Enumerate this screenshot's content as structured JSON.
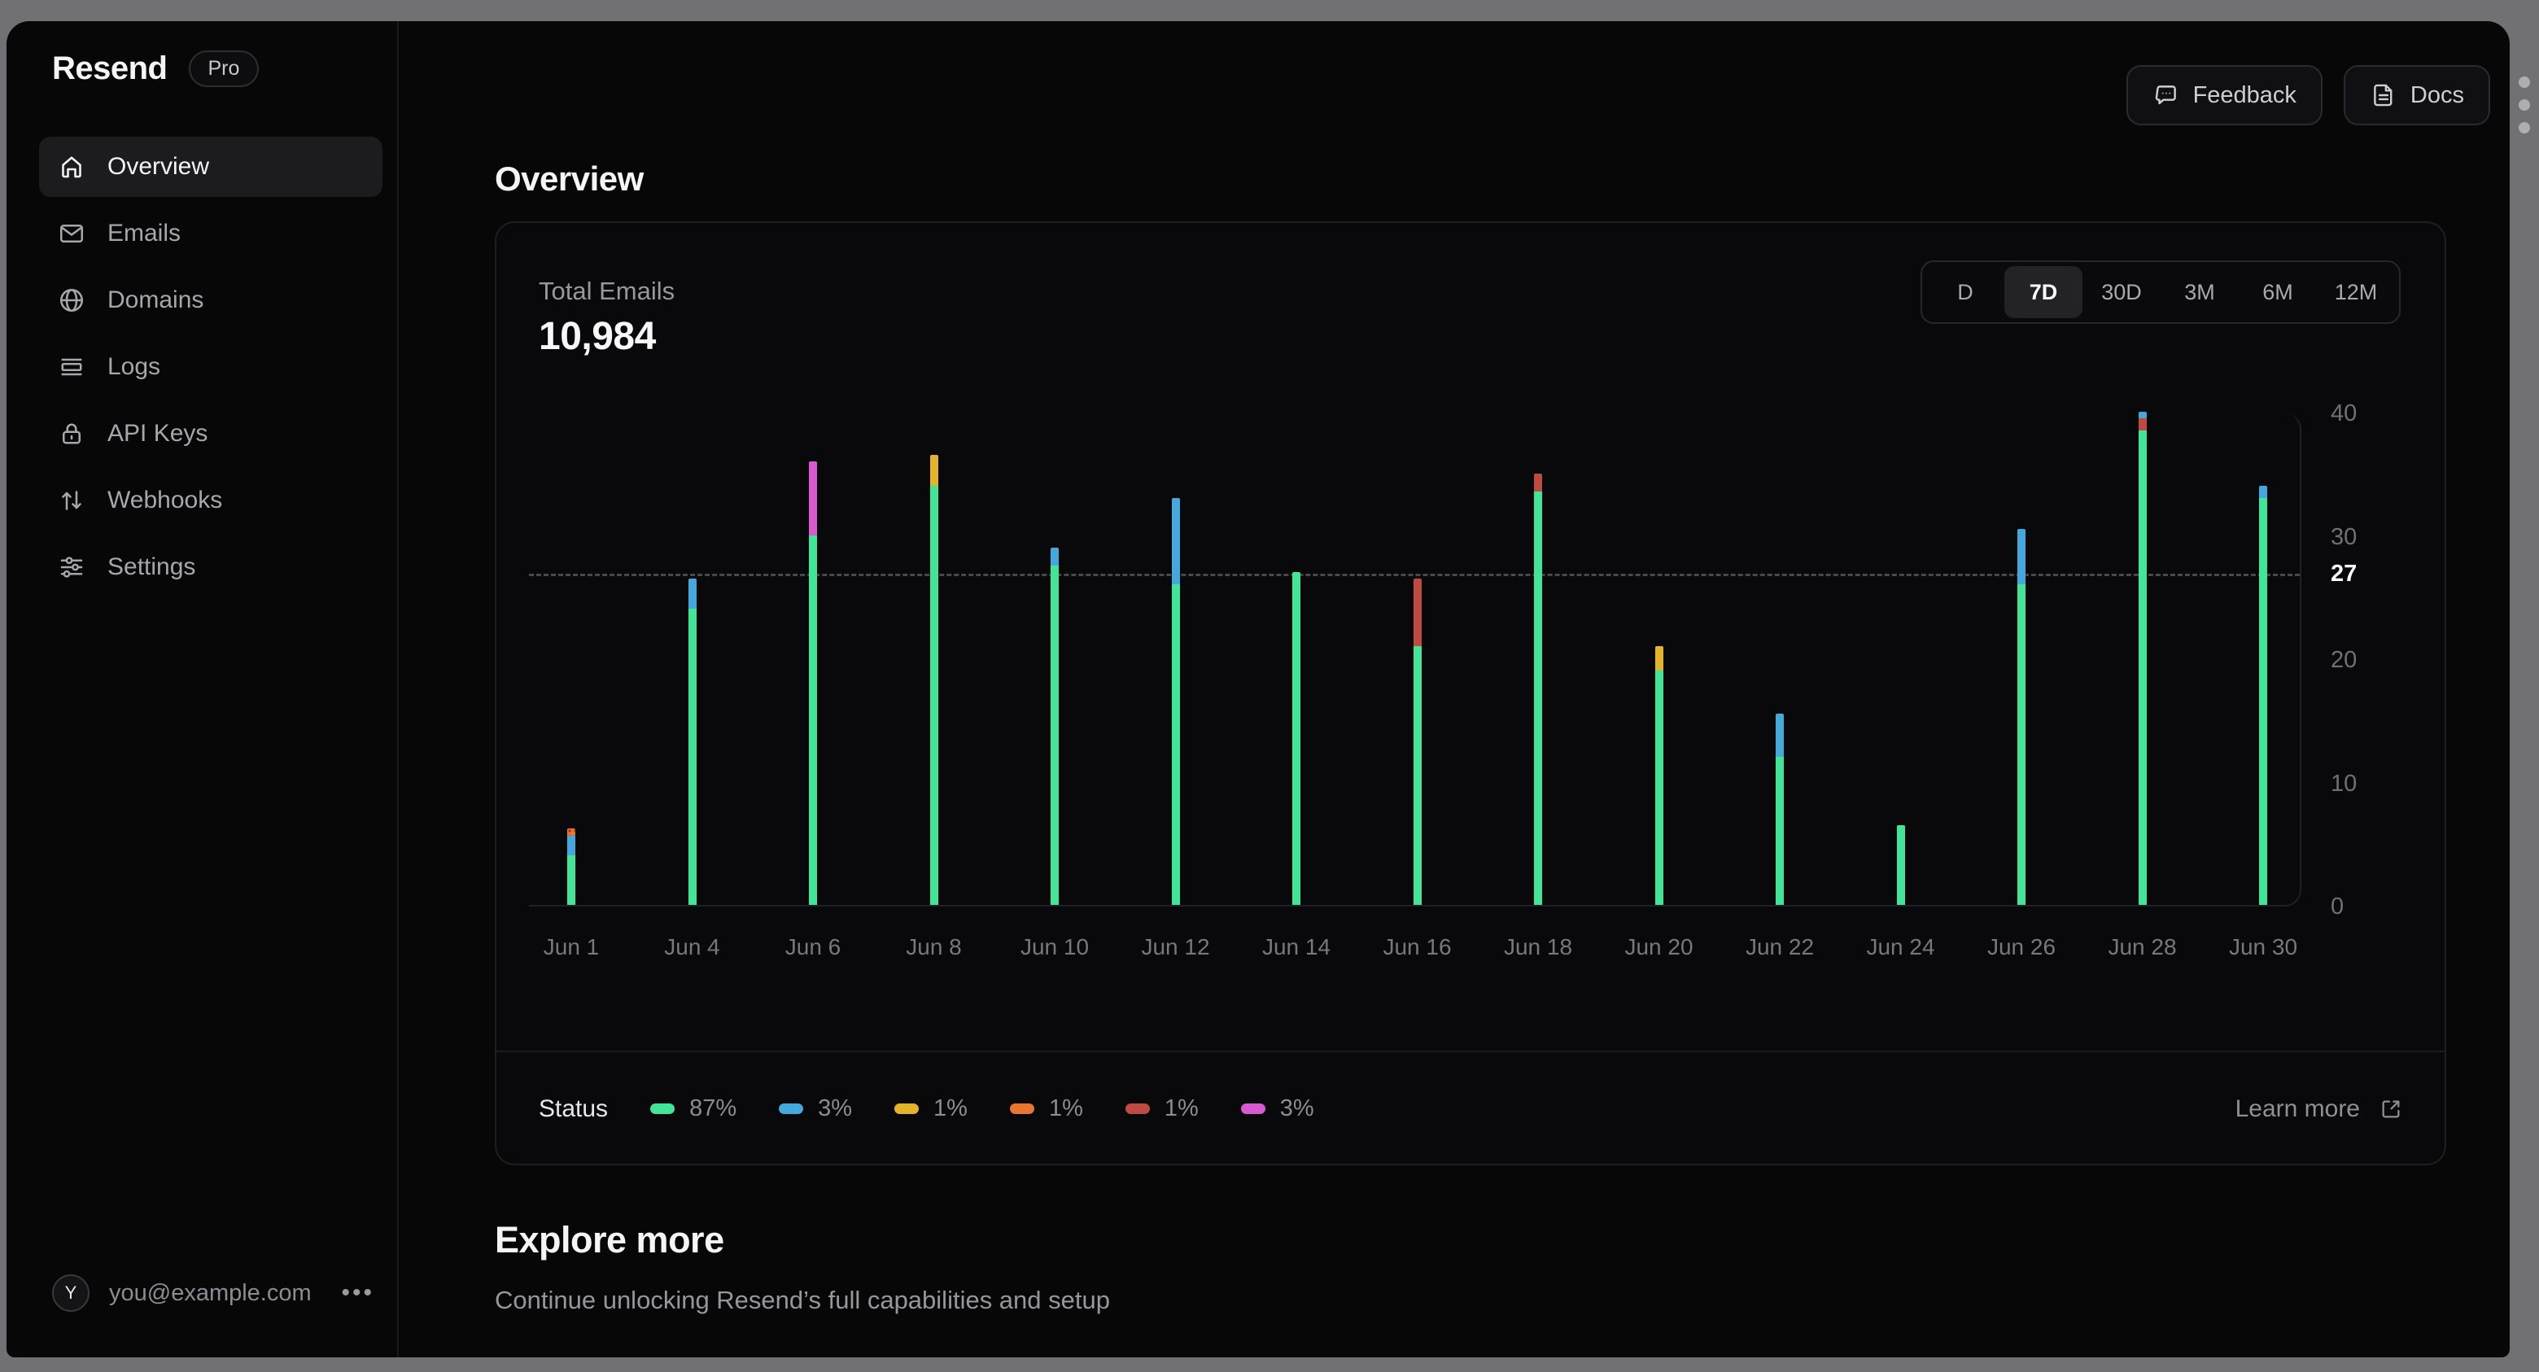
{
  "sidebar": {
    "logo": "Resend",
    "plan_badge": "Pro",
    "items": [
      {
        "label": "Overview",
        "icon": "home",
        "active": true
      },
      {
        "label": "Emails",
        "icon": "mail",
        "active": false
      },
      {
        "label": "Domains",
        "icon": "globe",
        "active": false
      },
      {
        "label": "Logs",
        "icon": "logs",
        "active": false
      },
      {
        "label": "API Keys",
        "icon": "lock",
        "active": false
      },
      {
        "label": "Webhooks",
        "icon": "arrows-up-down",
        "active": false
      },
      {
        "label": "Settings",
        "icon": "sliders",
        "active": false
      }
    ],
    "account": {
      "avatar_initial": "Y",
      "email": "you@example.com",
      "menu_icon": "•••"
    }
  },
  "header": {
    "buttons": [
      {
        "label": "Feedback",
        "icon": "feedback-bubble"
      },
      {
        "label": "Docs",
        "icon": "document"
      }
    ]
  },
  "page": {
    "title": "Overview"
  },
  "card": {
    "stat_label": "Total Emails",
    "stat_value": "10,984",
    "time_ranges": [
      {
        "label": "D",
        "active": false
      },
      {
        "label": "7D",
        "active": true
      },
      {
        "label": "30D",
        "active": false
      },
      {
        "label": "3M",
        "active": false
      },
      {
        "label": "6M",
        "active": false
      },
      {
        "label": "12M",
        "active": false
      }
    ],
    "footer": {
      "legend_label": "Status",
      "learn_more_label": "Learn more"
    }
  },
  "explore": {
    "title": "Explore more",
    "subtitle": "Continue unlocking Resend’s full capabilities and setup"
  },
  "chart_data": {
    "type": "bar",
    "stacked": true,
    "title": "Total Emails",
    "x_labels": [
      "Jun 1",
      "Jun 4",
      "Jun 6",
      "Jun 8",
      "Jun 10",
      "Jun 12",
      "Jun 14",
      "Jun 16",
      "Jun 18",
      "Jun 20",
      "Jun 22",
      "Jun 24",
      "Jun 26",
      "Jun 28",
      "Jun 30"
    ],
    "ylim": [
      0,
      40
    ],
    "yticks": [
      0,
      10,
      20,
      30,
      40
    ],
    "reference_line": {
      "value": 27,
      "style": "dashed"
    },
    "status_colors": {
      "green": "#42e598",
      "blue": "#45a8dc",
      "yellow": "#e3b42a",
      "orange": "#e8762f",
      "red": "#bf4a41",
      "magenta": "#d85ad0"
    },
    "bars": [
      {
        "date": "Jun 1",
        "segments": [
          {
            "status": "green",
            "value": 4
          },
          {
            "status": "blue",
            "value": 1.6
          },
          {
            "status": "orange",
            "value": 0.6
          }
        ]
      },
      {
        "date": "Jun 4",
        "segments": [
          {
            "status": "green",
            "value": 24
          },
          {
            "status": "blue",
            "value": 2.5
          }
        ]
      },
      {
        "date": "Jun 6",
        "segments": [
          {
            "status": "green",
            "value": 30
          },
          {
            "status": "magenta",
            "value": 6
          }
        ]
      },
      {
        "date": "Jun 8",
        "segments": [
          {
            "status": "green",
            "value": 34
          },
          {
            "status": "yellow",
            "value": 2.5
          }
        ]
      },
      {
        "date": "Jun 10",
        "segments": [
          {
            "status": "green",
            "value": 27.5
          },
          {
            "status": "blue",
            "value": 1.5
          }
        ]
      },
      {
        "date": "Jun 12",
        "segments": [
          {
            "status": "green",
            "value": 26
          },
          {
            "status": "blue",
            "value": 7
          }
        ]
      },
      {
        "date": "Jun 14",
        "segments": [
          {
            "status": "green",
            "value": 27
          }
        ]
      },
      {
        "date": "Jun 16",
        "segments": [
          {
            "status": "green",
            "value": 21
          },
          {
            "status": "red",
            "value": 5.5
          }
        ]
      },
      {
        "date": "Jun 18",
        "segments": [
          {
            "status": "green",
            "value": 33.5
          },
          {
            "status": "red",
            "value": 1.5
          }
        ]
      },
      {
        "date": "Jun 20",
        "segments": [
          {
            "status": "green",
            "value": 19
          },
          {
            "status": "yellow",
            "value": 2
          }
        ]
      },
      {
        "date": "Jun 22",
        "segments": [
          {
            "status": "green",
            "value": 12
          },
          {
            "status": "blue",
            "value": 3.5
          }
        ]
      },
      {
        "date": "Jun 24",
        "segments": [
          {
            "status": "green",
            "value": 6.5
          }
        ]
      },
      {
        "date": "Jun 26",
        "segments": [
          {
            "status": "green",
            "value": 26
          },
          {
            "status": "blue",
            "value": 4.5
          }
        ]
      },
      {
        "date": "Jun 28",
        "segments": [
          {
            "status": "green",
            "value": 38.5
          },
          {
            "status": "red",
            "value": 1
          },
          {
            "status": "blue",
            "value": 0.5
          }
        ]
      },
      {
        "date": "Jun 30",
        "segments": [
          {
            "status": "green",
            "value": 33
          },
          {
            "status": "blue",
            "value": 1
          }
        ]
      }
    ],
    "legend": [
      {
        "status": "green",
        "percent": "87%"
      },
      {
        "status": "blue",
        "percent": "3%"
      },
      {
        "status": "yellow",
        "percent": "1%"
      },
      {
        "status": "orange",
        "percent": "1%",
        "pattern": "dotted"
      },
      {
        "status": "red",
        "percent": "1%"
      },
      {
        "status": "magenta",
        "percent": "3%"
      }
    ],
    "legend_position": "bottom-left",
    "grid": false
  }
}
